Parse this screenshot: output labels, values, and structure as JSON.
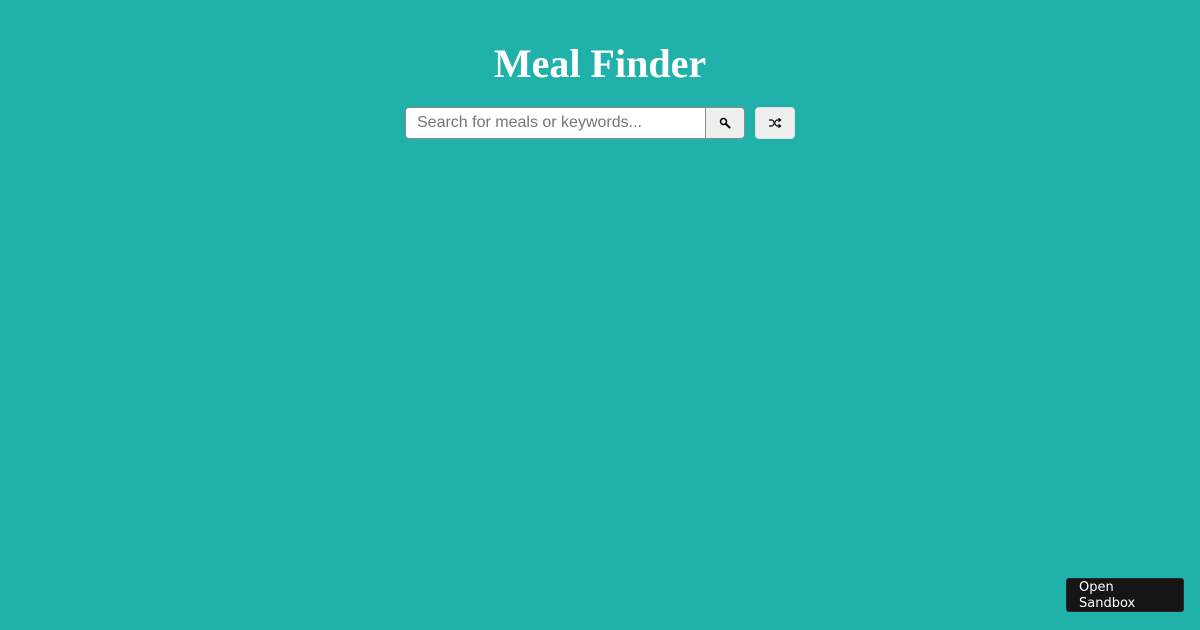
{
  "header": {
    "title": "Meal Finder"
  },
  "search": {
    "placeholder": "Search for meals or keywords...",
    "value": "",
    "submit_icon": "search-icon",
    "random_icon": "shuffle-icon"
  },
  "sandbox": {
    "label": "Open Sandbox"
  },
  "colors": {
    "background": "#20b1aa",
    "title": "#ffffff",
    "button_bg": "#efefef",
    "sandbox_bg": "#151515"
  }
}
